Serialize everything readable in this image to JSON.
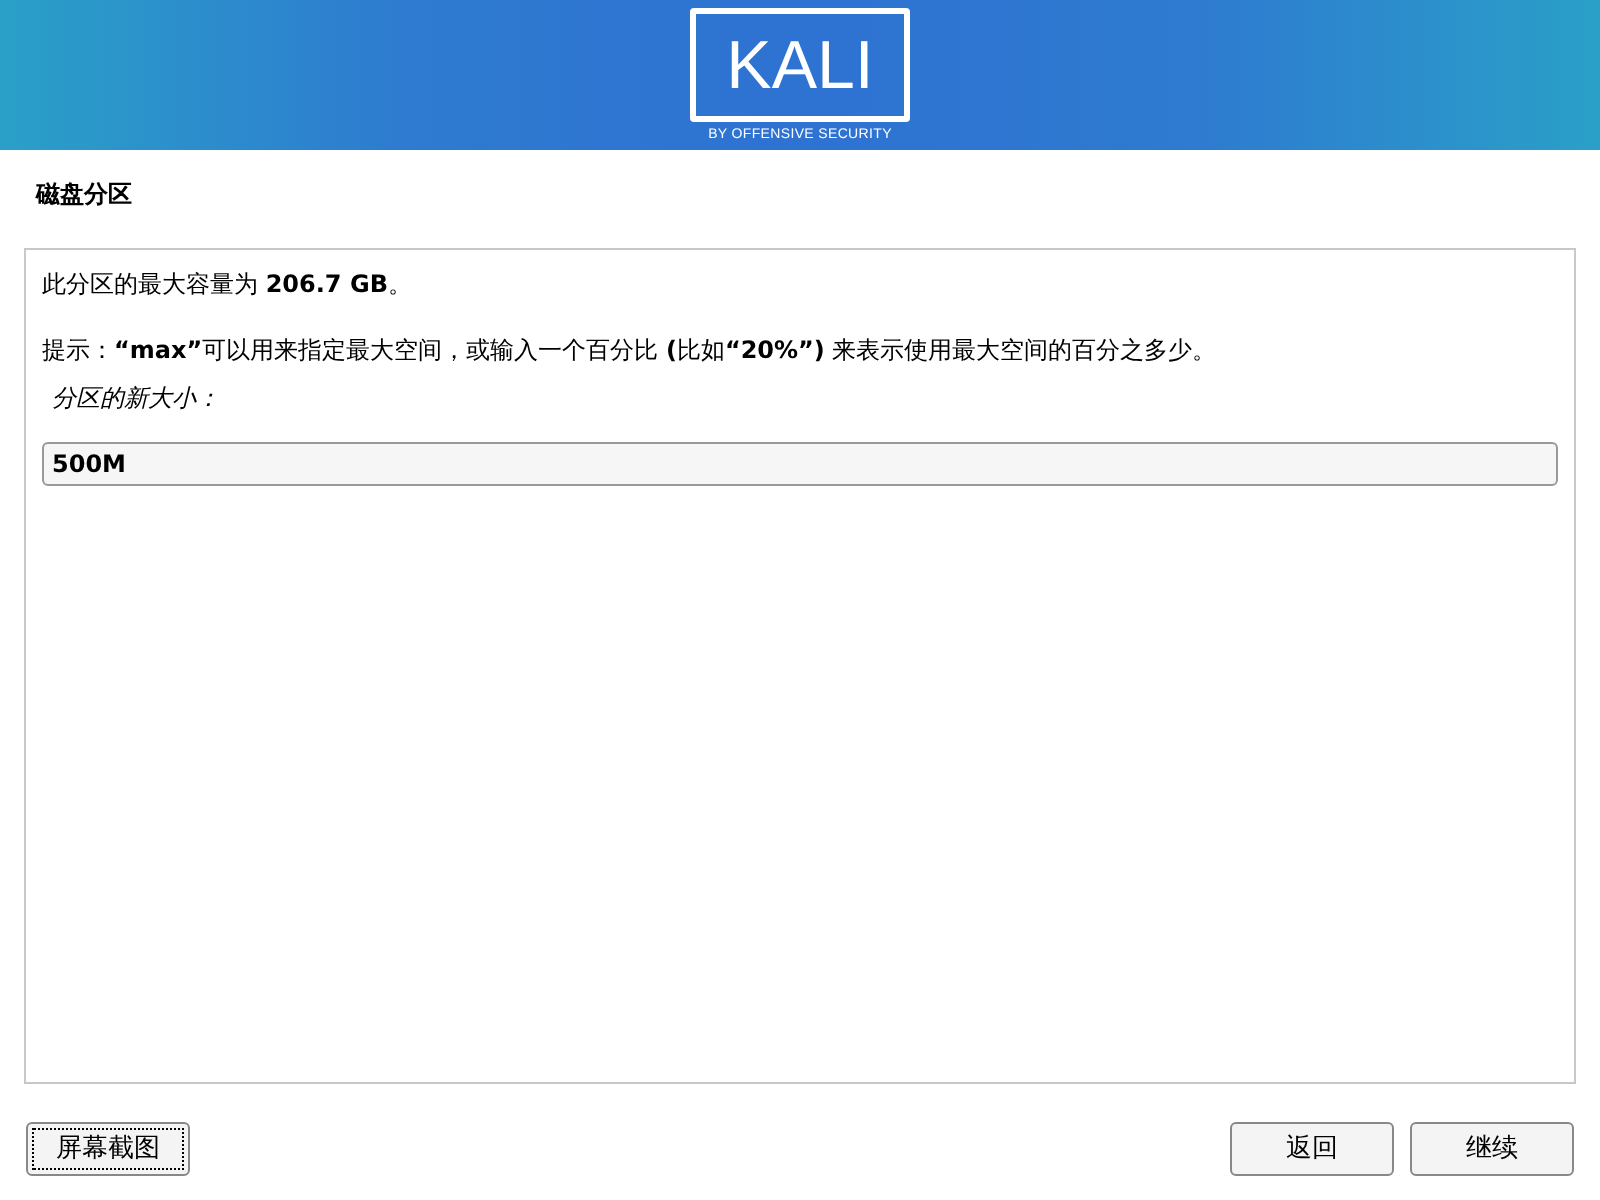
{
  "logo": {
    "wordmark": "KALI",
    "tagline": "BY OFFENSIVE SECURITY"
  },
  "page_title": "磁盘分区",
  "info": "此分区的最大容量为 **206.7 GB**。",
  "hint": "提示：**“max”**可以用来指定最大空间，或输入一个百分比 **(**比如**“20%”)** 来表示使用最大空间的百分之多少。",
  "field": {
    "label": "分区的新大小：",
    "value": "500M"
  },
  "buttons": [
    {
      "label": "屏幕截图",
      "kind": "left",
      "focused": true
    },
    {
      "label": "返回",
      "kind": "right",
      "focused": false
    },
    {
      "label": "继续",
      "kind": "right",
      "focused": false
    }
  ]
}
